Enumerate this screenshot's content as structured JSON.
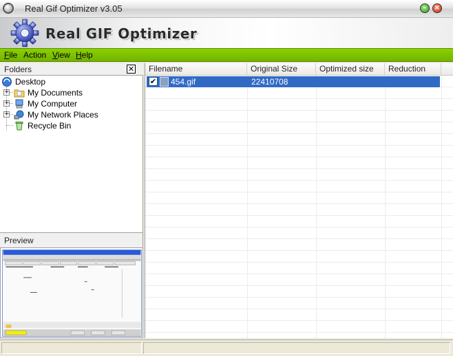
{
  "window": {
    "title": "Real Gif Optimizer  v3.05",
    "banner_title": "Real GIF Optimizer"
  },
  "menu": [
    {
      "label_underline": "F",
      "label_rest": "ile"
    },
    {
      "label_underline": "",
      "label_rest": "Action"
    },
    {
      "label_underline": "V",
      "label_rest": "iew"
    },
    {
      "label_underline": "H",
      "label_rest": "elp"
    }
  ],
  "folders": {
    "title": "Folders",
    "close_label": "✕",
    "tree": [
      {
        "label": "Desktop",
        "icon": "desktop-icon"
      },
      {
        "label": "My Documents",
        "icon": "folder-icon"
      },
      {
        "label": "My Computer",
        "icon": "computer-icon"
      },
      {
        "label": "My Network Places",
        "icon": "network-icon"
      },
      {
        "label": "Recycle Bin",
        "icon": "recycle-bin-icon"
      }
    ]
  },
  "preview": {
    "title": "Preview"
  },
  "file_list": {
    "columns": [
      "Filename",
      "Original Size",
      "Optimized size",
      "Reduction"
    ],
    "rows": [
      {
        "checked": true,
        "filename": "454.gif",
        "original_size": "22410708",
        "optimized_size": "",
        "reduction": ""
      }
    ]
  },
  "colors": {
    "menubar": "#80c400",
    "selection": "#316ac5"
  }
}
